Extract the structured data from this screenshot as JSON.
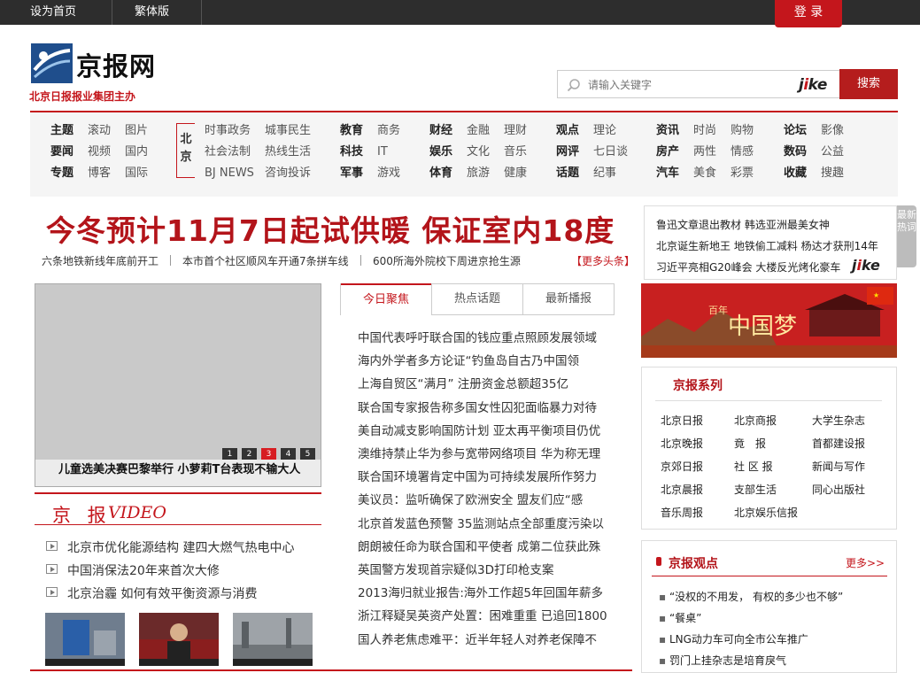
{
  "topbar": {
    "set_home": "设为首页",
    "traditional": "繁体版",
    "login": "登 录"
  },
  "logo": {
    "name": "京报网",
    "subtitle": "北京日报报业集团主办"
  },
  "search": {
    "placeholder": "请输入关键字",
    "brand": "jike",
    "button": "搜索"
  },
  "nav": {
    "col1": [
      [
        "主题",
        "滚动",
        "图片"
      ],
      [
        "要闻",
        "视频",
        "国内"
      ],
      [
        "专题",
        "博客",
        "国际"
      ]
    ],
    "beijing_tag": [
      "北",
      "京"
    ],
    "col2": [
      [
        "时事政务",
        "城事民生"
      ],
      [
        "社会法制",
        "热线生活"
      ],
      [
        "BJ NEWS",
        "咨询投诉"
      ]
    ],
    "col3": [
      [
        "教育",
        "商务"
      ],
      [
        "科技",
        "IT"
      ],
      [
        "军事",
        "游戏"
      ]
    ],
    "col4": [
      [
        "财经",
        "金融",
        "理财"
      ],
      [
        "娱乐",
        "文化",
        "音乐"
      ],
      [
        "体育",
        "旅游",
        "健康"
      ]
    ],
    "col5": [
      [
        "观点",
        "理论"
      ],
      [
        "网评",
        "七日谈"
      ],
      [
        "话题",
        "纪事"
      ]
    ],
    "col6": [
      [
        "资讯",
        "时尚",
        "购物"
      ],
      [
        "房产",
        "两性",
        "情感"
      ],
      [
        "汽车",
        "美食",
        "彩票"
      ]
    ],
    "col7": [
      [
        "论坛",
        "影像"
      ],
      [
        "数码",
        "公益"
      ],
      [
        "收藏",
        "搜趣"
      ]
    ]
  },
  "headline": {
    "title": "今冬预计11月7日起试供暖 保证室内18度",
    "subs": [
      "六条地铁新线年底前开工",
      "本市首个社区顺风车开通7条拼车线",
      "600所海外院校下周进京抢生源"
    ],
    "more": "【更多头条】"
  },
  "hot": {
    "items": [
      "鲁迅文章退出教材 韩选亚洲最美女神",
      "北京诞生新地王 地铁偷工减料 杨达才获刑14年",
      "习近平亮相G20峰会 大楼反光烤化豪车"
    ],
    "brand": "jike",
    "side_tab": "最新热词"
  },
  "slideshow": {
    "caption": "儿童选美决赛巴黎举行 小萝莉T台表现不输大人",
    "pages": [
      "1",
      "2",
      "3",
      "4",
      "5"
    ],
    "active_page": 3
  },
  "video": {
    "title_cn": "京 报",
    "title_en": "VIDEO",
    "items": [
      "北京市优化能源结构 建四大燃气热电中心",
      "中国消保法20年来首次大修",
      "北京治霾 如何有效平衡资源与消费"
    ]
  },
  "tabs": {
    "labels": [
      "今日聚焦",
      "热点话题",
      "最新播报"
    ],
    "active": 0
  },
  "news": [
    "中国代表呼吁联合国的钱应重点照顾发展领域",
    "海内外学者多方论证“钓鱼岛自古乃中国领",
    "上海自贸区“满月” 注册资金总额超35亿",
    "联合国专家报告称多国女性囚犯面临暴力对待",
    "美自动减支影响国防计划 亚太再平衡项目仍优",
    "澳维持禁止华为参与宽带网络项目 华为称无理",
    "联合国环境署肯定中国为可持续发展所作努力",
    "美议员：监听确保了欧洲安全 盟友们应“感",
    "北京首发蓝色预警 35监测站点全部重度污染以",
    "朗朗被任命为联合国和平使者 成第二位获此殊",
    "英国警方发现首宗疑似3D打印枪支案",
    "2013海归就业报告:海外工作超5年回国年薪多",
    "浙江释疑吴英资产处置：困难重重 已追回1800",
    "国人养老焦虑难平：近半年轻人对养老保障不"
  ],
  "dream": {
    "small": "百年",
    "big": "中国梦"
  },
  "series": {
    "title": "京报系列",
    "items": [
      [
        "北京日报",
        "北京商报",
        "大学生杂志"
      ],
      [
        "北京晚报",
        "竟　报",
        "首都建设报"
      ],
      [
        "京郊日报",
        "社 区 报",
        "新闻与写作"
      ],
      [
        "北京晨报",
        "支部生活",
        "同心出版社"
      ],
      [
        "音乐周报",
        "北京娱乐信报",
        ""
      ]
    ]
  },
  "opinion": {
    "title": "京报观点",
    "more": "更多>>",
    "items": [
      "“没权的不用发， 有权的多少也不够”",
      "“餐桌”",
      "LNG动力车可向全市公车推广",
      "罚门上挂杂志是培育戾气"
    ]
  },
  "colors": {
    "brand_red": "#c4161c",
    "dark_bar": "#2d2d2d"
  }
}
